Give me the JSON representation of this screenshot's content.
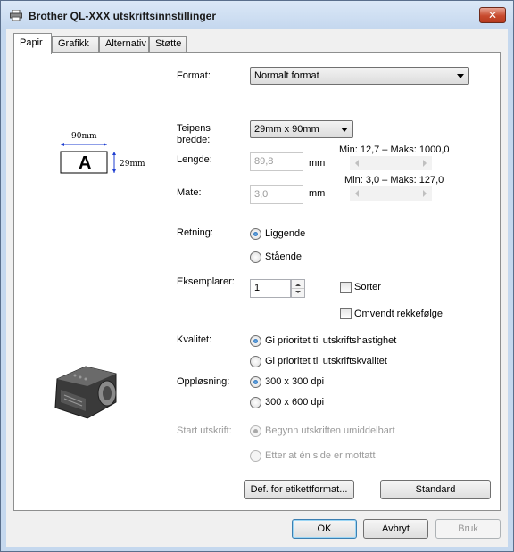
{
  "window": {
    "title": "Brother QL-XXX utskriftsinnstillinger",
    "close_label": "✕"
  },
  "tabs": [
    {
      "label": "Papir",
      "active": true
    },
    {
      "label": "Grafikk",
      "active": false
    },
    {
      "label": "Alternativ",
      "active": false
    },
    {
      "label": "Støtte",
      "active": false
    }
  ],
  "paper": {
    "format_label": "Format:",
    "format_value": "Normalt format",
    "tape_width_label_line1": "Teipens",
    "tape_width_label_line2": "bredde:",
    "tape_width_value": "29mm x 90mm",
    "length_label": "Lengde:",
    "length_value": "89,8",
    "length_unit": "mm",
    "length_range": "Min: 12,7 – Maks: 1000,0",
    "feed_label": "Mate:",
    "feed_value": "3,0",
    "feed_unit": "mm",
    "feed_range": "Min: 3,0 – Maks: 127,0",
    "preview": {
      "width_text": "90mm",
      "height_text": "29mm",
      "letter": "A"
    },
    "orientation_label": "Retning:",
    "orientation_landscape": "Liggende",
    "orientation_portrait": "Stående",
    "copies_label": "Eksemplarer:",
    "copies_value": "1",
    "collate_label": "Sorter",
    "reverse_label": "Omvendt rekkefølge",
    "quality_label": "Kvalitet:",
    "quality_speed": "Gi prioritet til utskriftshastighet",
    "quality_quality": "Gi prioritet til utskriftskvalitet",
    "resolution_label": "Oppløsning:",
    "resolution_300": "300 x 300 dpi",
    "resolution_600": "300 x 600 dpi",
    "start_label": "Start utskrift:",
    "start_immediately": "Begynn utskriften umiddelbart",
    "start_after_page": "Etter at én side er mottatt",
    "label_format_button": "Def. for etikettformat...",
    "standard_button": "Standard"
  },
  "footer": {
    "ok": "OK",
    "cancel": "Avbryt",
    "apply": "Bruk"
  }
}
